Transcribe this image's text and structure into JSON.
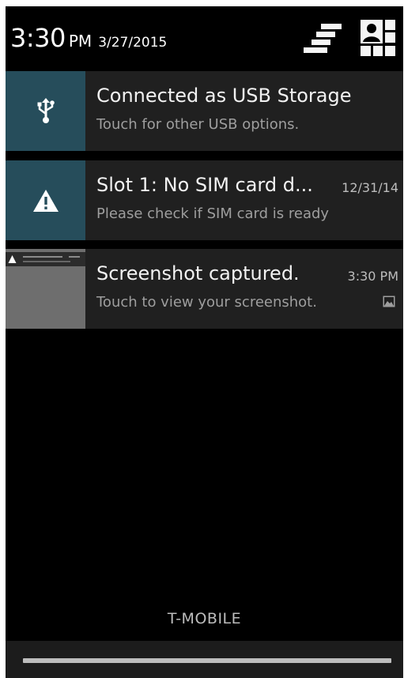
{
  "header": {
    "time": "3:30",
    "ampm": "PM",
    "date": "3/27/2015",
    "settings_icon": "quick-settings-icon",
    "user_icon": "user-switch-icon"
  },
  "notifications": [
    {
      "icon": "usb-icon",
      "title": "Connected as USB Storage",
      "text": "Touch for other USB options.",
      "time": ""
    },
    {
      "icon": "warning-icon",
      "title": "Slot 1: No SIM card d...",
      "text": "Please check if SIM card is ready",
      "time": "12/31/14"
    },
    {
      "icon": "screenshot-thumbnail",
      "title": "Screenshot captured.",
      "text": "Touch to view your screenshot.",
      "time": "3:30 PM",
      "badge_icon": "image-icon"
    }
  ],
  "footer": {
    "carrier": "T-MOBILE"
  },
  "colors": {
    "background": "#000000",
    "notification_bg": "#202020",
    "icon_box": "#264d5b",
    "title_text": "#f2f2f2",
    "body_text": "#9e9e9e"
  }
}
